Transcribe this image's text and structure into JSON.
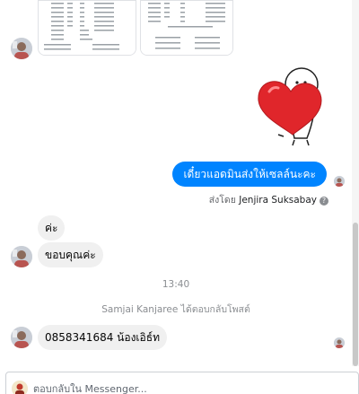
{
  "conversation": {
    "outgoing_message": "เดี๋ยวแอดมินส่งให้เซลล์นะคะ",
    "sent_by_prefix": "ส่งโดย",
    "sent_by_name": "Jenjira Suksabay",
    "help_glyph": "?",
    "incoming_messages": [
      {
        "text": "ค่ะ"
      },
      {
        "text": "ขอบคุณค่ะ"
      },
      {
        "text": "0858341684 น้องเอิธ์ท"
      }
    ],
    "timestamp": "13:40",
    "system_notice": "Samjai Kanjaree ได้ตอบกลับโพสต์",
    "attachments": [
      {
        "type": "document",
        "label": "document-thumbnail-1"
      },
      {
        "type": "document",
        "label": "document-thumbnail-2"
      }
    ],
    "sticker": "heart-hug-sticker"
  },
  "composer": {
    "placeholder": "ตอบกลับใน Messenger..."
  },
  "colors": {
    "outgoing_bubble": "#0084ff",
    "incoming_bubble": "#f0f0f0",
    "muted_text": "#8a8d91"
  }
}
